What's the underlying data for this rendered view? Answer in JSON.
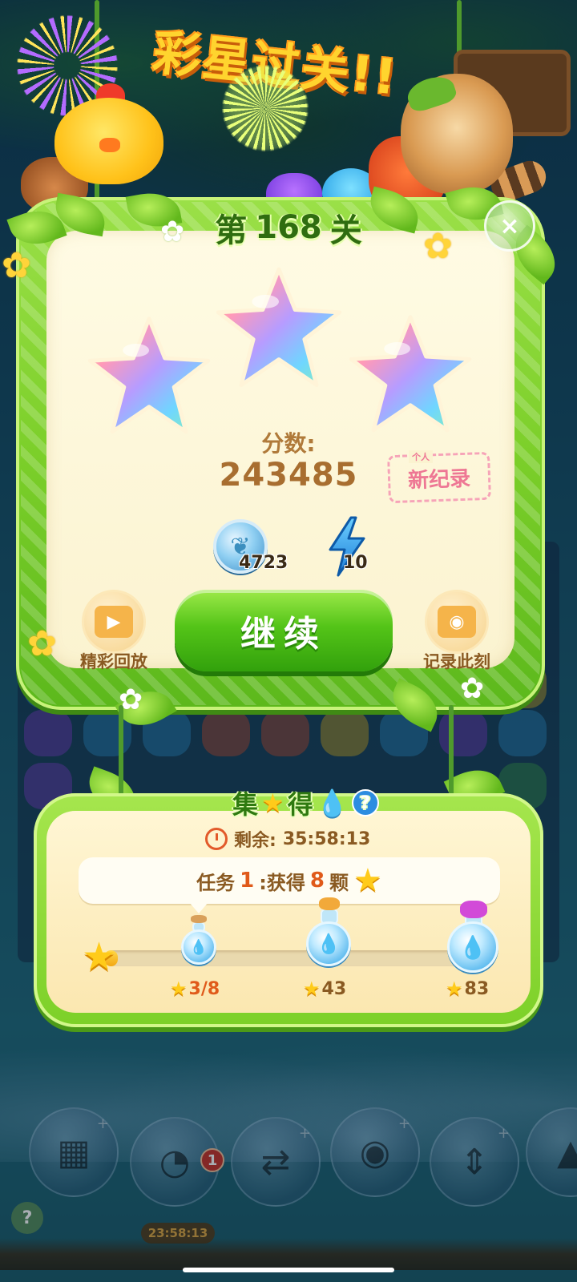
{
  "header": {
    "banner": "彩星过关!!"
  },
  "result": {
    "level_prefix": "第",
    "level_number": "168",
    "level_suffix": "关",
    "close_icon": "×",
    "stars_earned": 3,
    "stars_total": 3,
    "score_label": "分数:",
    "score_value": "243485",
    "record_small": "个人",
    "record_label": "新纪录",
    "rewards": [
      {
        "icon": "leaf-coin-icon",
        "count": "4723"
      },
      {
        "icon": "lightning-icon",
        "count": "10"
      }
    ],
    "replay_label": "精彩回放",
    "continue_label": "继续",
    "capture_label": "记录此刻"
  },
  "event": {
    "title_part1": "集",
    "title_part2": "得",
    "help_icon": "?",
    "countdown_label": "剩余:",
    "countdown_value": "35:58:13",
    "task_prefix": "任务",
    "task_number": "1",
    "task_middle": ":获得",
    "task_count": "8",
    "task_suffix": "颗",
    "progress_current": 3,
    "progress_max": 83,
    "milestones": [
      {
        "label": "3/8",
        "reached": true
      },
      {
        "label": "43",
        "reached": false
      },
      {
        "label": "83",
        "reached": false
      }
    ]
  },
  "background": {
    "bottom_badge": "1",
    "bottom_timer": "23:58:13",
    "help_icon": "?"
  },
  "colors": {
    "frame_green": "#7ccf2a",
    "panel_cream": "#fbf3d0",
    "score_brown": "#a86e30",
    "continue_green": "#54c418",
    "record_pink": "#ee7794",
    "banner_yellow": "#ffd42e"
  }
}
